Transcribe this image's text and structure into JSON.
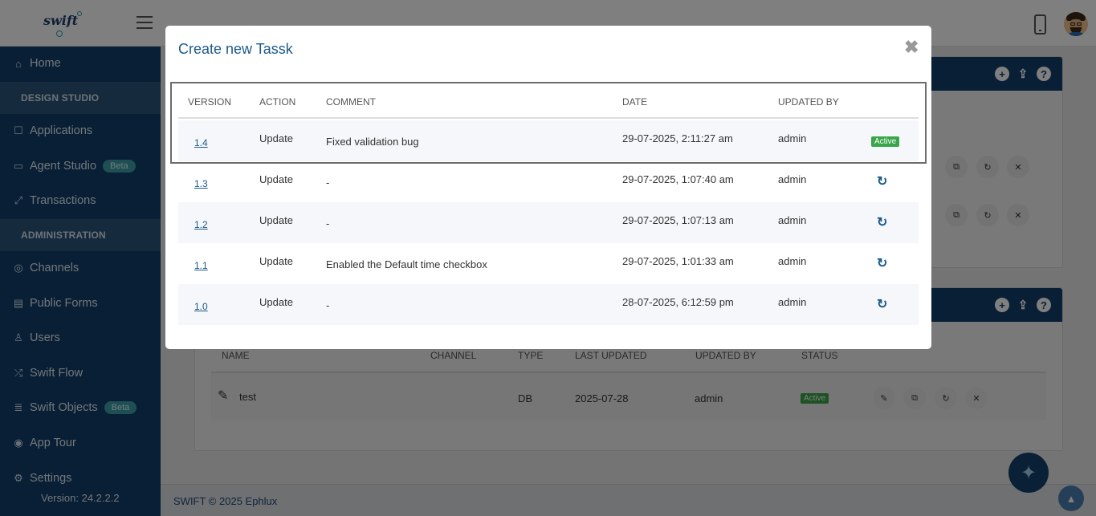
{
  "header": {
    "logo_text": "swift",
    "icons": [
      "hamburger-icon",
      "mobile-phone-icon",
      "user-avatar"
    ]
  },
  "sidebar": {
    "items": [
      {
        "label": "Home",
        "icon": "home-icon"
      },
      {
        "label": "DESIGN STUDIO",
        "section": true
      },
      {
        "label": "Applications",
        "icon": "applications-icon"
      },
      {
        "label": "Agent Studio",
        "icon": "agent-studio-icon",
        "badge": "Beta"
      },
      {
        "label": "Transactions",
        "icon": "transactions-icon"
      },
      {
        "label": "ADMINISTRATION",
        "section": true
      },
      {
        "label": "Channels",
        "icon": "channels-icon"
      },
      {
        "label": "Public Forms",
        "icon": "public-forms-icon"
      },
      {
        "label": "Users",
        "icon": "users-icon"
      },
      {
        "label": "Swift Flow",
        "icon": "swift-flow-icon"
      },
      {
        "label": "Swift Objects",
        "icon": "swift-objects-icon",
        "badge": "Beta"
      },
      {
        "label": "App Tour",
        "icon": "app-tour-icon"
      },
      {
        "label": "Settings",
        "icon": "settings-icon"
      }
    ],
    "version": "Version: 24.2.2.2"
  },
  "background_table": {
    "headers": [
      "NAME",
      "CHANNEL",
      "TYPE",
      "LAST UPDATED",
      "UPDATED BY",
      "STATUS"
    ],
    "row": {
      "name": "test",
      "channel": "",
      "type": "DB",
      "last_updated": "2025-07-28",
      "updated_by": "admin",
      "status": "Active"
    }
  },
  "footer": {
    "text": "SWIFT © 2025 Ephlux"
  },
  "modal": {
    "title": "Create new Tassk",
    "columns": {
      "version": "VERSION",
      "action": "ACTION",
      "comment": "COMMENT",
      "date": "DATE",
      "updated_by": "UPDATED BY"
    },
    "rows": [
      {
        "version": "1.4",
        "action": "Update",
        "comment": "Fixed validation bug",
        "date": "29-07-2025, 2:11:27 am",
        "updated_by": "admin",
        "status": "Active"
      },
      {
        "version": "1.3",
        "action": "Update",
        "comment": "-",
        "date": "29-07-2025, 1:07:40 am",
        "updated_by": "admin",
        "status": "restore"
      },
      {
        "version": "1.2",
        "action": "Update",
        "comment": "-",
        "date": "29-07-2025, 1:07:13 am",
        "updated_by": "admin",
        "status": "restore"
      },
      {
        "version": "1.1",
        "action": "Update",
        "comment": "Enabled the Default time checkbox",
        "date": "29-07-2025, 1:01:33 am",
        "updated_by": "admin",
        "status": "restore"
      },
      {
        "version": "1.0",
        "action": "Update",
        "comment": "-",
        "date": "28-07-2025, 6:12:59 pm",
        "updated_by": "admin",
        "status": "restore"
      }
    ]
  },
  "colors": {
    "sidebar": "#103e6a",
    "sidebar_section": "#2a5479",
    "accent": "#1c5a8a",
    "active": "#3aa54a",
    "beta": "#3a9fa8"
  }
}
